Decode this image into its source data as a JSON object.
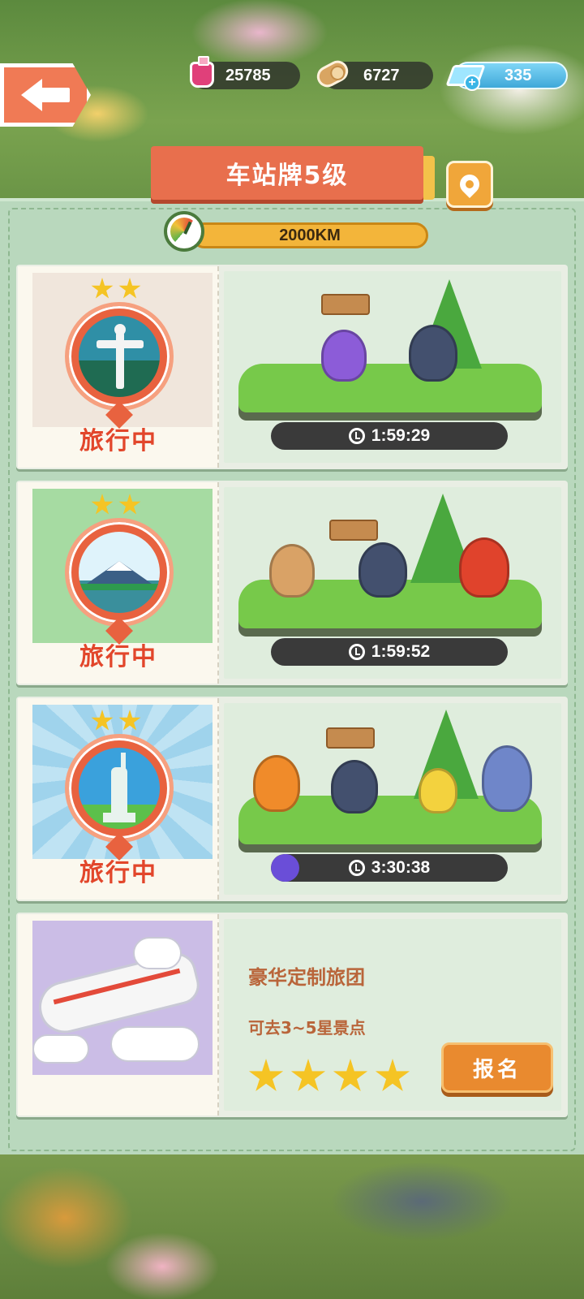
{
  "resources": {
    "ink": "25785",
    "wood": "6727",
    "gems": "335"
  },
  "header": {
    "title": "车站牌5级",
    "distance": "2000KM"
  },
  "trips": [
    {
      "status": "旅行中",
      "timer": "1:59:29",
      "stars": 2,
      "landmark": "christ-statue-icon",
      "progress": 0
    },
    {
      "status": "旅行中",
      "timer": "1:59:52",
      "stars": 2,
      "landmark": "mount-fuji-icon",
      "progress": 0
    },
    {
      "status": "旅行中",
      "timer": "3:30:38",
      "stars": 2,
      "landmark": "statue-of-liberty-icon",
      "progress": 0.12
    }
  ],
  "luxury_tour": {
    "title": "豪华定制旅团",
    "subtitle": "可去3~5星景点",
    "stars": 4,
    "signup_label": "报名"
  },
  "colors": {
    "accent_red": "#e8623f",
    "status_red": "#e2462b",
    "panel_green": "#b9d8bd",
    "button_orange": "#e98a2f"
  }
}
